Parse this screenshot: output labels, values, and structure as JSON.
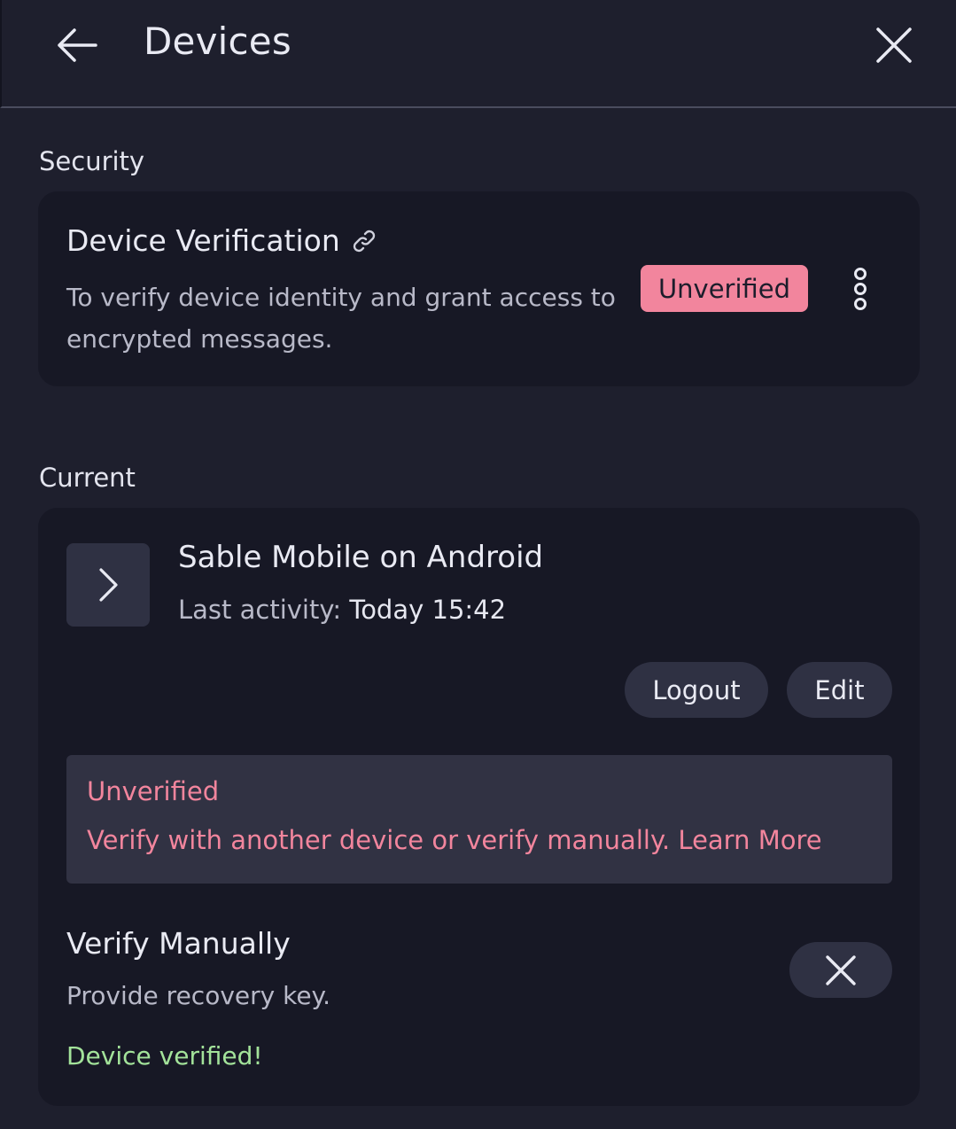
{
  "header": {
    "title": "Devices",
    "back_icon": "arrow-left-icon",
    "close_icon": "close-icon"
  },
  "security": {
    "section_label": "Security",
    "card_title": "Device Verification",
    "link_icon": "link-icon",
    "description": "To verify device identity and grant access to encrypted messages.",
    "badge": "Unverified",
    "menu_icon": "vertical-dots-icon"
  },
  "current": {
    "section_label": "Current",
    "device_name": "Sable Mobile on Android",
    "activity_label": "Last activity:",
    "activity_value": "Today 15:42",
    "logout_label": "Logout",
    "edit_label": "Edit",
    "warning": {
      "title": "Unverified",
      "text": "Verify with another device or verify manually.",
      "link": "Learn More"
    },
    "verify_manually": {
      "title": "Verify Manually",
      "description": "Provide recovery key.",
      "success": "Device verified!"
    }
  },
  "colors": {
    "background": "#1e1f2d",
    "card": "#171825",
    "danger": "#f2859d",
    "success": "#a3e39a"
  }
}
